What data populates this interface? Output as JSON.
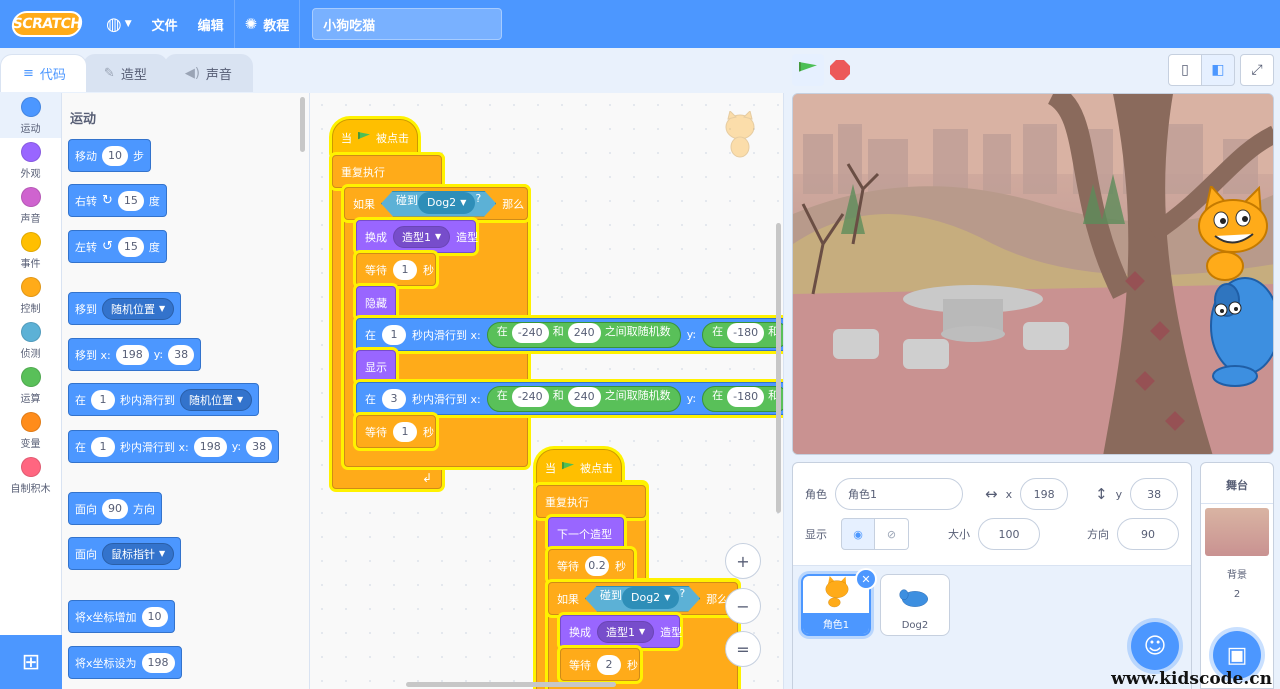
{
  "menubar": {
    "logo": "SCRATCH",
    "file": "文件",
    "edit": "编辑",
    "tutorials": "教程",
    "project_title": "小狗吃猫"
  },
  "tabs": [
    "代码",
    "造型",
    "声音"
  ],
  "categories": [
    {
      "label": "运动",
      "color": "#4c97ff"
    },
    {
      "label": "外观",
      "color": "#9966ff"
    },
    {
      "label": "声音",
      "color": "#cf63cf"
    },
    {
      "label": "事件",
      "color": "#ffbf00"
    },
    {
      "label": "控制",
      "color": "#ffab19"
    },
    {
      "label": "侦测",
      "color": "#5cb1d6"
    },
    {
      "label": "运算",
      "color": "#59c059"
    },
    {
      "label": "变量",
      "color": "#ff8c1a"
    },
    {
      "label": "自制积木",
      "color": "#ff6680"
    }
  ],
  "palette": {
    "title": "运动",
    "move": {
      "a": "移动",
      "n": "10",
      "b": "步"
    },
    "turn_right": {
      "a": "右转",
      "n": "15",
      "b": "度"
    },
    "turn_left": {
      "a": "左转",
      "n": "15",
      "b": "度"
    },
    "goto": {
      "a": "移到",
      "d": "随机位置"
    },
    "goto_xy": {
      "a": "移到 x:",
      "x": "198",
      "b": "y:",
      "y": "38"
    },
    "glide": {
      "a": "在",
      "n": "1",
      "b": "秒内滑行到",
      "d": "随机位置"
    },
    "glide_xy": {
      "a": "在",
      "n": "1",
      "b": "秒内滑行到 x:",
      "x": "198",
      "c": "y:",
      "y": "38"
    },
    "point": {
      "a": "面向",
      "n": "90",
      "b": "方向"
    },
    "point_towards": {
      "a": "面向",
      "d": "鼠标指针"
    },
    "change_x": {
      "a": "将x坐标增加",
      "n": "10"
    },
    "set_x": {
      "a": "将x坐标设为",
      "n": "198"
    }
  },
  "script1": {
    "hat_a": "当",
    "hat_b": "被点击",
    "forever": "重复执行",
    "if": "如果",
    "touching": "碰到",
    "target": "Dog2",
    "q": "?",
    "then": "那么",
    "switch": "换成",
    "costume": "造型1",
    "costume_b": "造型",
    "wait": "等待",
    "wait_n": "1",
    "sec": "秒",
    "hide": "隐藏",
    "glide_a": "在",
    "glide_n": "1",
    "glide_b": "秒内滑行到 x:",
    "rand_a": "在",
    "rand_lo": "-240",
    "rand_and": "和",
    "rand_hi": "240",
    "rand_b": "之间取随机数",
    "y": "y:",
    "y_a": "在",
    "y_lo": "-180",
    "y_cut": "和",
    "show": "显示",
    "glide2_n": "3",
    "wait2_n": "1"
  },
  "script2": {
    "hat_a": "当",
    "hat_b": "被点击",
    "forever": "重复执行",
    "next": "下一个造型",
    "wait": "等待",
    "wait_n": "0.2",
    "sec": "秒",
    "if": "如果",
    "touching": "碰到",
    "target": "Dog2",
    "q": "?",
    "then": "那么",
    "switch": "换成",
    "costume": "造型1",
    "costume_b": "造型",
    "wait2_n": "2"
  },
  "zoom": {
    "in": "+",
    "out": "−",
    "reset": "="
  },
  "sprite_info": {
    "sprite_label": "角色",
    "sprite_name": "角色1",
    "x_label": "x",
    "x": "198",
    "y_label": "y",
    "y": "38",
    "show_label": "显示",
    "size_label": "大小",
    "size": "100",
    "dir_label": "方向",
    "dir": "90"
  },
  "sprites": [
    {
      "name": "角色1"
    },
    {
      "name": "Dog2"
    }
  ],
  "stage_pane": {
    "title": "舞台",
    "bg_label": "背景",
    "bg_count": "2"
  },
  "watermark": "www.kidscode.cn"
}
